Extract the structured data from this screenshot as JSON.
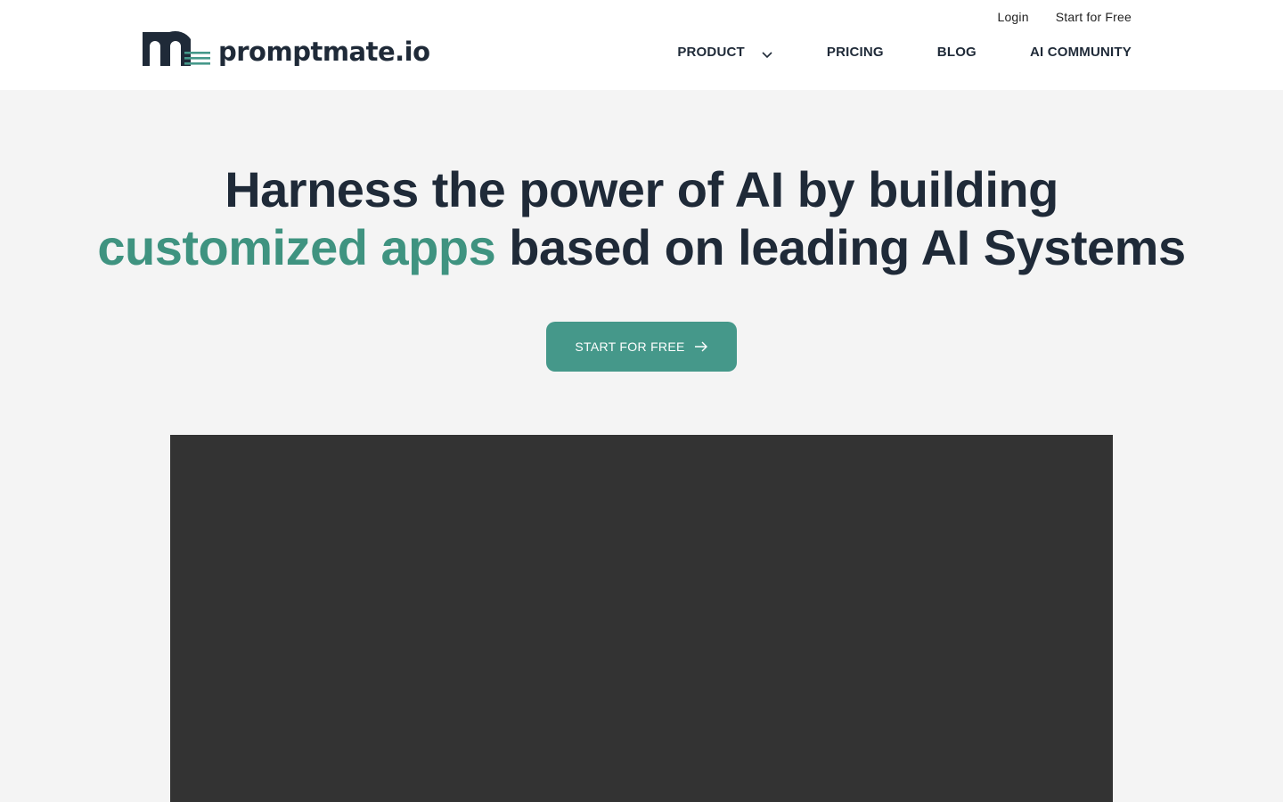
{
  "header": {
    "logo_text": "promptmate.io",
    "top_links": {
      "login": "Login",
      "start": "Start for Free"
    },
    "nav": {
      "product": "PRODUCT",
      "pricing": "PRICING",
      "blog": "BLOG",
      "community": "AI COMMUNITY"
    }
  },
  "hero": {
    "line1": "Harness the power of AI by building",
    "line2_accent": "customized apps",
    "line2_rest": " based on leading AI Systems",
    "cta_label": "START FOR FREE"
  },
  "colors": {
    "accent": "#45988a",
    "text": "#1f2a38",
    "background": "#f4f4f4",
    "video_bg": "#333333"
  },
  "icons": [
    "logo-mark-icon",
    "chevron-down-icon",
    "arrow-right-icon"
  ]
}
